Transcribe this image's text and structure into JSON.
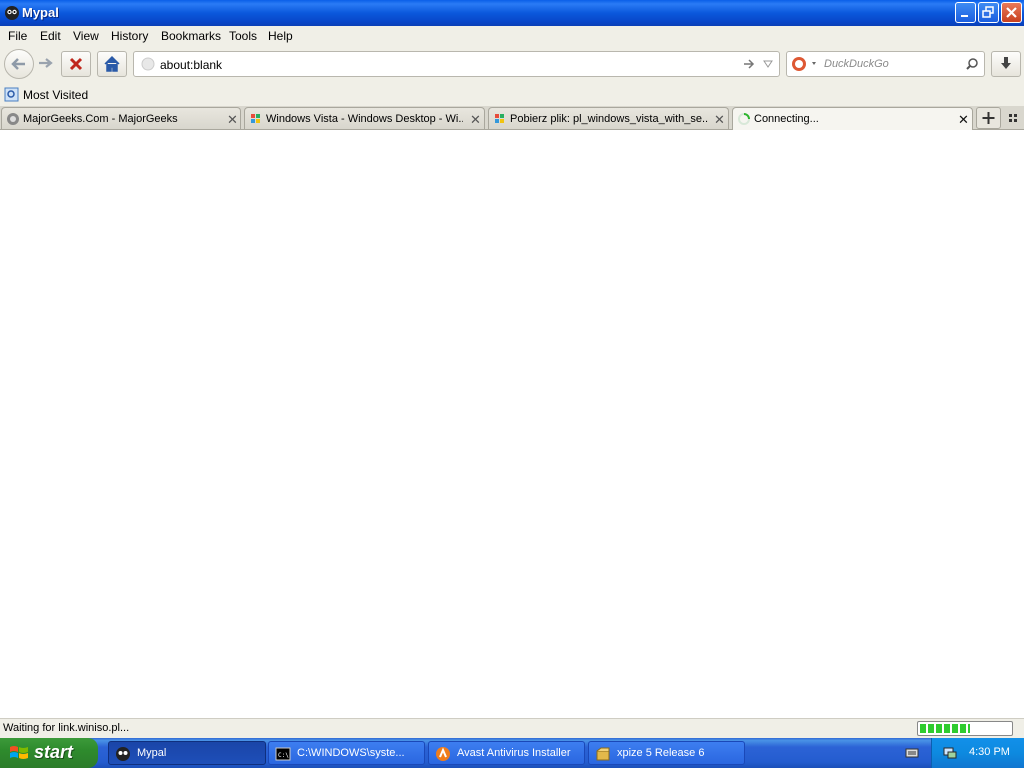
{
  "window": {
    "title": "Mypal"
  },
  "menu": [
    "File",
    "Edit",
    "View",
    "History",
    "Bookmarks",
    "Tools",
    "Help"
  ],
  "urlbar": {
    "value": "about:blank"
  },
  "search": {
    "placeholder": "DuckDuckGo"
  },
  "bookmarks": {
    "most_visited": "Most Visited"
  },
  "tabs": [
    {
      "label": "MajorGeeks.Com - MajorGeeks"
    },
    {
      "label": "Windows Vista - Windows Desktop - Wi..."
    },
    {
      "label": "Pobierz plik: pl_windows_vista_with_se..."
    },
    {
      "label": "Connecting..."
    }
  ],
  "status": {
    "text": "Waiting for link.winiso.pl...",
    "progress": 0.55
  },
  "taskbar": {
    "start": "start",
    "items": [
      "Mypal",
      "C:\\WINDOWS\\syste...",
      "Avast Antivirus Installer",
      "xpize 5 Release 6"
    ],
    "clock": "4:30 PM"
  },
  "colors": {
    "title_bar": "#0b58dc",
    "taskbar": "#245ccf",
    "start": "#2e8b2d"
  }
}
